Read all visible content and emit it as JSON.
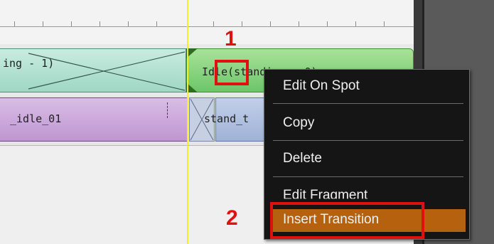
{
  "timeline": {
    "clip_walk_label": "ing - 1)",
    "clip_idle_label": "Idle(standing - 0)",
    "clip_idle01_label": "_idle_01",
    "clip_stand_label": "stand_t"
  },
  "context_menu": {
    "items": [
      {
        "label": "Edit On Spot"
      },
      {
        "label": "Copy"
      },
      {
        "label": "Delete"
      },
      {
        "label": "Edit Fragment"
      },
      {
        "label": "Insert Transition",
        "highlighted": true
      }
    ]
  },
  "annotations": {
    "step1": "1",
    "step2": "2"
  },
  "colors": {
    "highlight": "#b5610d",
    "annotation": "#e01010",
    "playhead": "#f2ee2b"
  }
}
